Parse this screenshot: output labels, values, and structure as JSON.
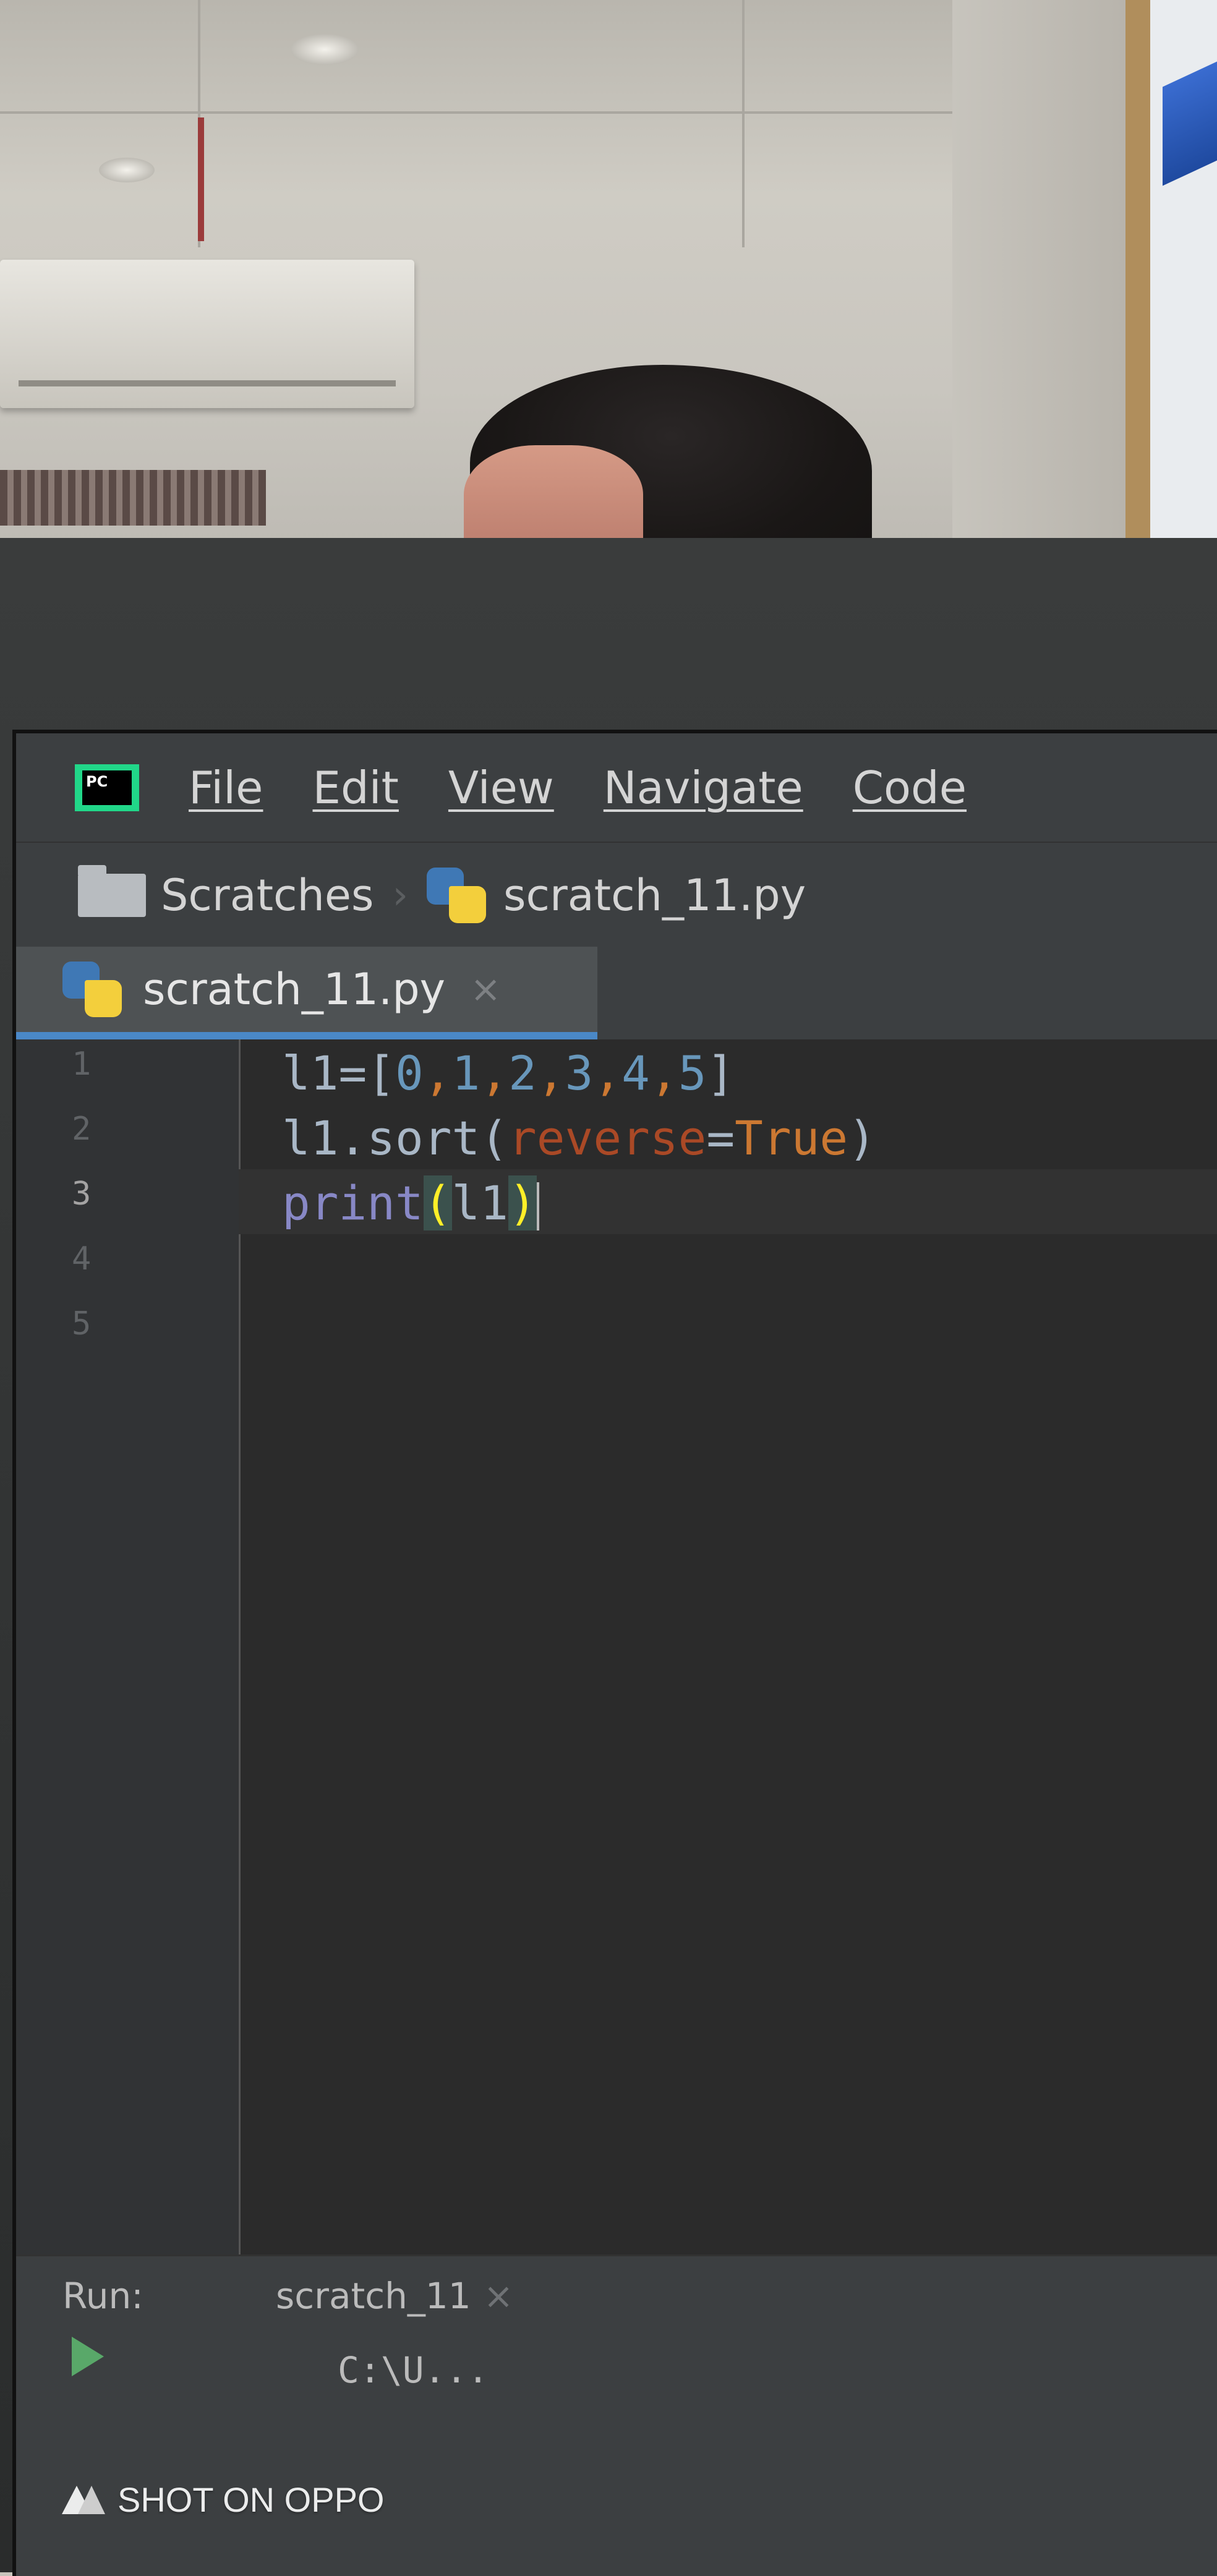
{
  "menu": {
    "logo_text": "PC",
    "items": [
      "File",
      "Edit",
      "View",
      "Navigate",
      "Code"
    ]
  },
  "breadcrumb": {
    "folder": "Scratches",
    "file": "scratch_11.py"
  },
  "tab": {
    "label": "scratch_11.py",
    "close": "×"
  },
  "editor": {
    "line_numbers": [
      "1",
      "2",
      "3",
      "4",
      "5"
    ],
    "active_line": 3,
    "code": {
      "l1_var": "l1=",
      "l1_open": "[",
      "l1_nums": [
        "0",
        "1",
        "2",
        "3",
        "4",
        "5"
      ],
      "l1_close": "]",
      "l2_prefix": "l1.sort(",
      "l2_param": "reverse",
      "l2_eq": "=",
      "l2_value": "True",
      "l2_close": ")",
      "l3_builtin": "print",
      "l3_open": "(",
      "l3_arg": "l1",
      "l3_close": ")"
    }
  },
  "run_panel": {
    "label": "Run:",
    "tab": "scratch_11",
    "close": "×",
    "path": "C:\\U..."
  },
  "watermark": {
    "text": "SHOT ON OPPO"
  },
  "colors": {
    "accent": "#4a88c7",
    "logo_green": "#21d789",
    "number": "#6897bb",
    "keyword": "#cc7832",
    "param": "#aa4926",
    "builtin": "#8888c6"
  }
}
